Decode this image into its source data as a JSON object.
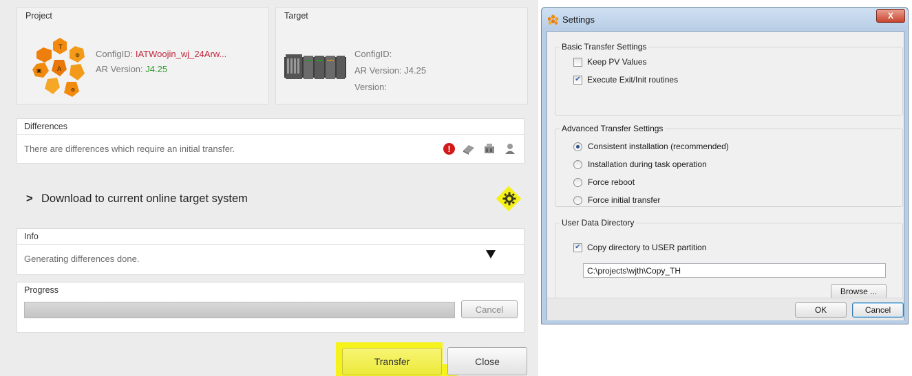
{
  "project": {
    "title": "Project",
    "config_label": "ConfigID:",
    "config_value": "IATWoojin_wj_24Arw...",
    "ar_label": "AR Version:",
    "ar_value": "J4.25"
  },
  "target": {
    "title": "Target",
    "config_label": "ConfigID:",
    "ar_label": "AR Version:",
    "ar_value": "J4.25",
    "version_label": "Version:"
  },
  "differences": {
    "title": "Differences",
    "message": "There are differences which require an initial transfer.",
    "icons": [
      "error-icon",
      "module-icon",
      "hardware-icon",
      "user-icon"
    ]
  },
  "download": {
    "chevron": ">",
    "label": "Download to current online target system"
  },
  "info": {
    "title": "Info",
    "message": "Generating differences done."
  },
  "progress": {
    "title": "Progress",
    "cancel_label": "Cancel"
  },
  "buttons": {
    "transfer": "Transfer",
    "close": "Close"
  },
  "colors": {
    "highlight": "#f6f31c",
    "config_value": "#c0283c",
    "version_value": "#2e9a2e"
  },
  "settings": {
    "title": "Settings",
    "close_glyph": "X",
    "basic": {
      "title": "Basic Transfer Settings",
      "options": [
        {
          "label": "Keep PV Values",
          "checked": false
        },
        {
          "label": "Execute Exit/Init routines",
          "checked": true
        }
      ]
    },
    "advanced": {
      "title": "Advanced Transfer Settings",
      "options": [
        {
          "label": "Consistent installation (recommended)",
          "selected": true
        },
        {
          "label": "Installation during task operation",
          "selected": false
        },
        {
          "label": "Force reboot",
          "selected": false
        },
        {
          "label": "Force initial transfer",
          "selected": false
        }
      ]
    },
    "user_data": {
      "title": "User Data Directory",
      "copy_label": "Copy directory to USER partition",
      "copy_checked": true,
      "path_value": "C:\\projects\\wjth\\Copy_TH",
      "browse_label": "Browse ..."
    },
    "ok_label": "OK",
    "cancel_label": "Cancel"
  }
}
